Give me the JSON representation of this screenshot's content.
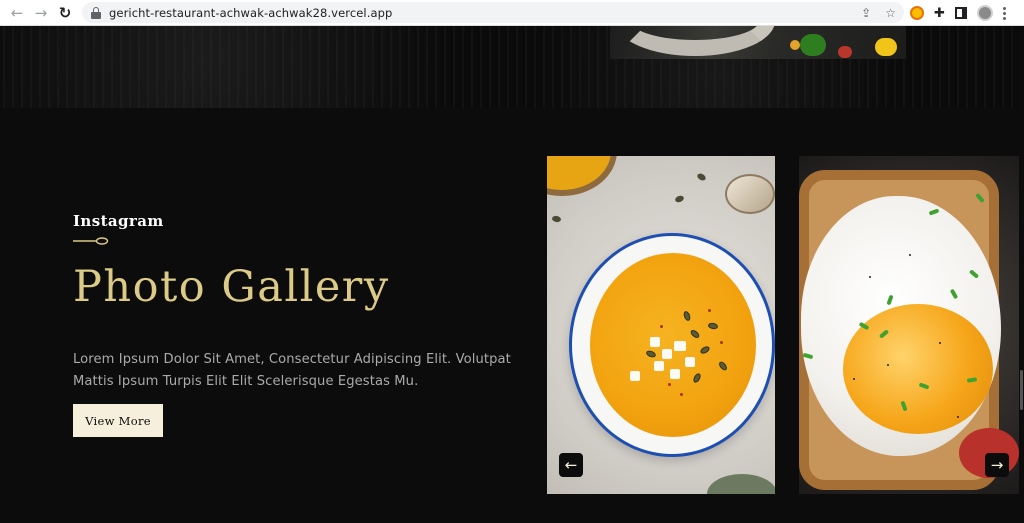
{
  "browser": {
    "url": "gericht-restaurant-achwak-achwak28.vercel.app"
  },
  "colors": {
    "accent_gold": "#dcca87",
    "button_bg": "#f5efdb",
    "page_bg": "#0c0c0c"
  },
  "icons": {
    "back": "arrow-left-icon",
    "forward": "arrow-right-icon",
    "reload": "reload-icon",
    "lock": "lock-icon",
    "share": "share-icon",
    "bookmark": "star-icon",
    "extension": "puzzle-icon",
    "side_panel": "side-panel-icon",
    "profile": "avatar-icon",
    "menu": "kebab-menu-icon"
  },
  "gallery_section": {
    "subtitle": "Instagram",
    "title": "Photo Gallery",
    "description": "Lorem Ipsum Dolor Sit Amet, Consectetur Adipiscing Elit. Volutpat Mattis Ipsum Turpis Elit Elit Scelerisque Egestas Mu.",
    "button_label": "View More"
  },
  "carousel": {
    "images": [
      "pumpkin soup bowl",
      "fried egg on toast"
    ],
    "prev_arrow": "←",
    "next_arrow": "→"
  }
}
